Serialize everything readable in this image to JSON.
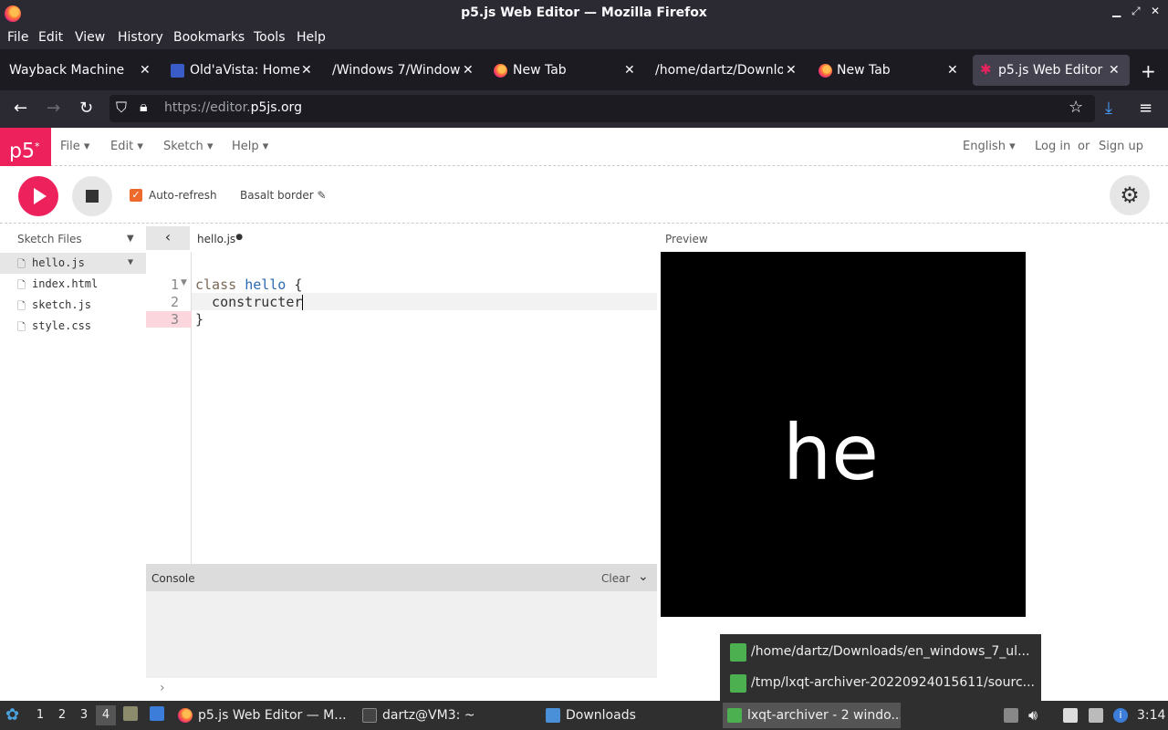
{
  "window": {
    "title": "p5.js Web Editor — Mozilla Firefox"
  },
  "menubar": {
    "items": [
      "File",
      "Edit",
      "View",
      "History",
      "Bookmarks",
      "Tools",
      "Help"
    ]
  },
  "tabs": [
    {
      "label": "Wayback Machine",
      "icon": "none"
    },
    {
      "label": "Old'aVista: Home",
      "icon": "oldavista-icon"
    },
    {
      "label": "/Windows 7/Windows",
      "icon": "none"
    },
    {
      "label": "New Tab",
      "icon": "firefox-icon"
    },
    {
      "label": "/home/dartz/Downloa",
      "icon": "none"
    },
    {
      "label": "New Tab",
      "icon": "firefox-icon"
    },
    {
      "label": "p5.js Web Editor",
      "icon": "p5-star-icon",
      "active": true
    }
  ],
  "navbar": {
    "url_prefix": "https://editor.",
    "url_domain": "p5js.org"
  },
  "p5header": {
    "logo": "p5",
    "logo_sup": "*",
    "menus": [
      "File",
      "Edit",
      "Sketch",
      "Help"
    ],
    "language": "English",
    "login": "Log in",
    "or": "or",
    "signup": "Sign up"
  },
  "toolbar": {
    "auto_refresh_label": "Auto-refresh",
    "auto_refresh_checked": true,
    "sketch_name": "Basalt border"
  },
  "sidebar": {
    "header": "Sketch Files",
    "files": [
      {
        "name": "hello.js",
        "selected": true
      },
      {
        "name": "index.html",
        "selected": false
      },
      {
        "name": "sketch.js",
        "selected": false
      },
      {
        "name": "style.css",
        "selected": false
      }
    ]
  },
  "editor": {
    "file_tab": "hello.js",
    "unsaved_dot": "●",
    "lines": [
      {
        "num": "1",
        "keyword": "class",
        "name": "hello",
        "rest": " {"
      },
      {
        "num": "2",
        "text": "  constructer"
      },
      {
        "num": "3",
        "text": "}"
      }
    ]
  },
  "console": {
    "title": "Console",
    "clear": "Clear",
    "prompt": "›"
  },
  "preview": {
    "label": "Preview",
    "canvas_text": "he"
  },
  "popup": {
    "items": [
      "/home/dartz/Downloads/en_windows_7_ul...",
      "/tmp/lxqt-archiver-20220924015611/sourc..."
    ]
  },
  "taskbar": {
    "desktops": [
      "1",
      "2",
      "3",
      "4"
    ],
    "active_desktop": "4",
    "windows": [
      {
        "label": "p5.js Web Editor — M...",
        "active": false
      },
      {
        "label": "dartz@VM3: ~",
        "active": false
      },
      {
        "label": "Downloads",
        "active": false
      },
      {
        "label": "lxqt-archiver - 2 windo...",
        "active": true
      }
    ],
    "clock": "3:14"
  },
  "colors": {
    "p5_pink": "#ed225d",
    "firefox_dark": "#2b2a33",
    "tabbar_dark": "#1c1b22",
    "taskbar": "#2f2f2f",
    "checkbox_orange": "#ed6a2c"
  }
}
